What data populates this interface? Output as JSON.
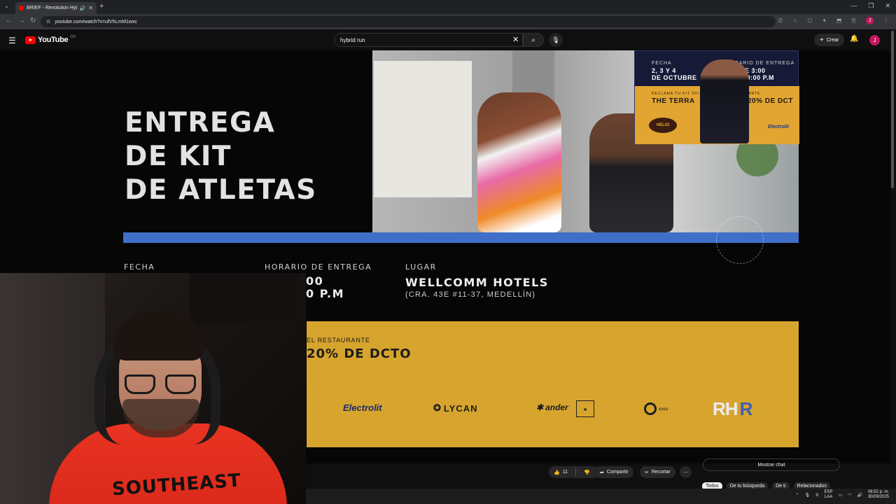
{
  "browser": {
    "tab_title": "BRIEF - Revolution Hybrid",
    "url": "youtube.com/watch?v=ufVhLmM1wxc",
    "profile_initial": "J"
  },
  "youtube": {
    "logo_text": "YouTube",
    "country_code": "CO",
    "search_value": "hybrid run",
    "create_label": "Crear",
    "avatar_initial": "J"
  },
  "video": {
    "headline": [
      "ENTREGA",
      "DE KIT",
      "DE ATLETAS"
    ],
    "inset": {
      "fecha_label": "FECHA",
      "fecha_value_1": "2, 3 Y 4",
      "fecha_value_2": "DE OCTUBRE",
      "horario_label": "HORARIO DE ENTREGA",
      "horario_value_1": "DE 3:00",
      "horario_value_2": "A 9:00 P.M",
      "promo_small": "RECLAMA TU KIT OFICIAL EN EL RESTAURANTE",
      "promo_big_1": "THE TERRA",
      "promo_big_2": "N 20% DE DCT",
      "logo_1": "HELIO",
      "logo_2": "Electrolit"
    },
    "labels": {
      "fecha": "FECHA",
      "horario": "HORARIO DE ENTREGA",
      "lugar": "LUGAR"
    },
    "horario_fragment_1": "00",
    "horario_fragment_2": "0 P.M",
    "lugar_value": "WELLCOMM HOTELS",
    "lugar_address": "(CRA. 43E #11-37, MEDELLÍN)",
    "promo_small": "EL RESTAURANTE",
    "promo_big": "20% DE DCTO",
    "sponsors": [
      "Electrolit",
      "LYCAN",
      "ander",
      "RH",
      "R"
    ],
    "shirt_text": "SOUTHEAST"
  },
  "actions": {
    "like_count": "11",
    "share_label": "Compartir",
    "clip_label": "Recortar",
    "chat_label": "Mostrar chat"
  },
  "chips": [
    "Todos",
    "De tu búsqueda",
    "De ti",
    "Relacionados"
  ],
  "taskbar": {
    "lang_1": "ESP",
    "lang_2": "LAA",
    "time": "08:52 p. m.",
    "date": "30/09/2025"
  }
}
